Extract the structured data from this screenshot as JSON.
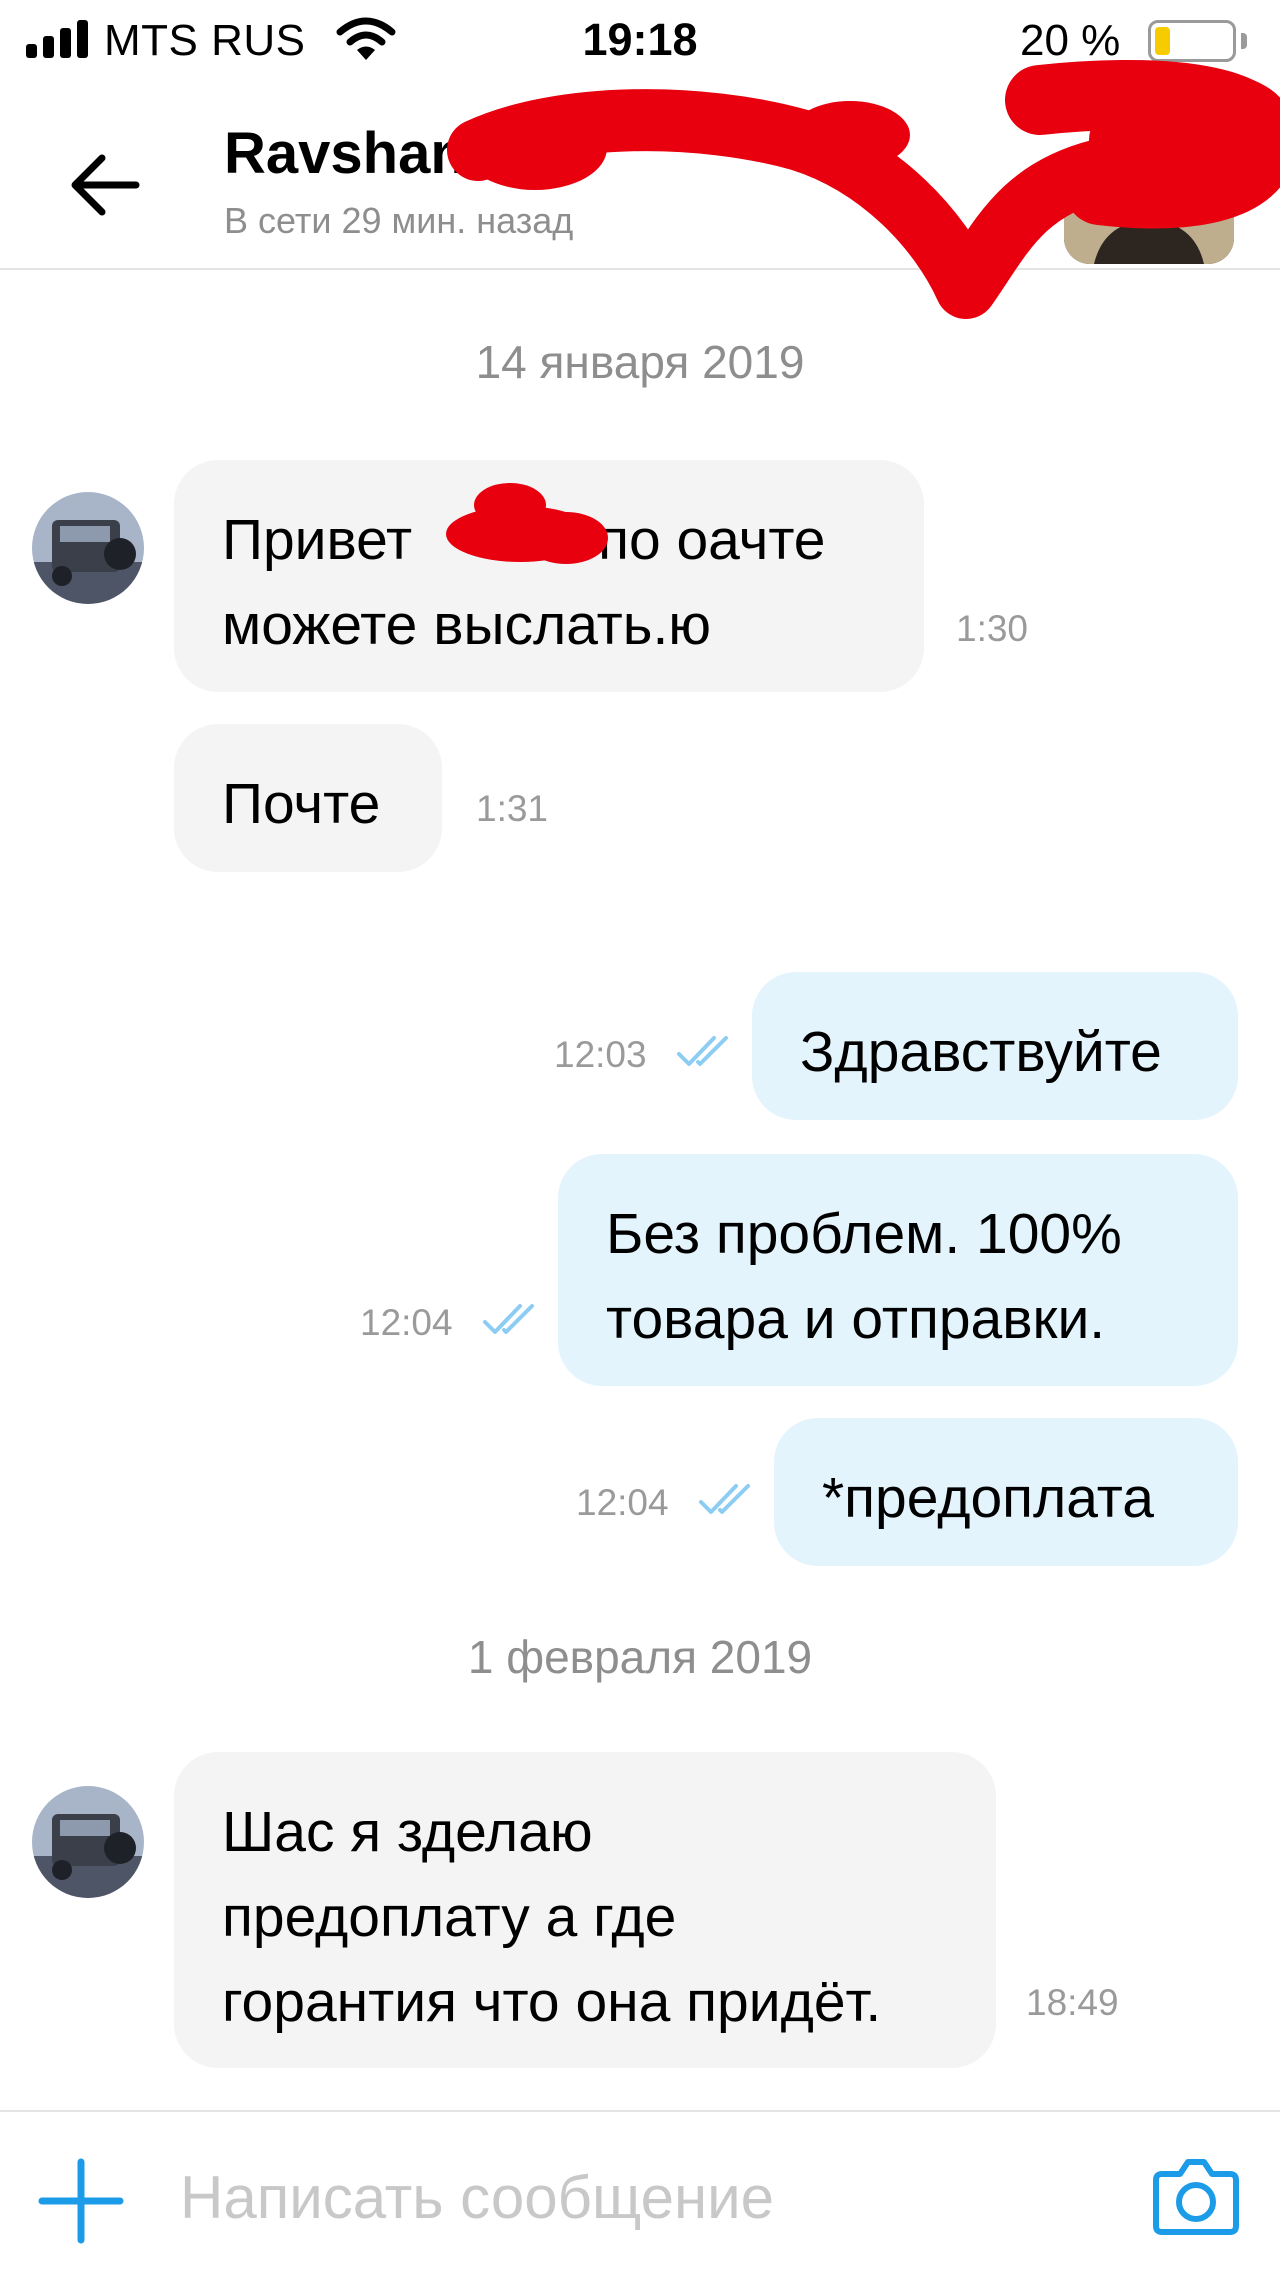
{
  "status_bar": {
    "carrier": "MTS RUS",
    "time": "19:18",
    "battery_text": "20 %",
    "battery_level": 0.2
  },
  "header": {
    "contact_name": "Ravshan",
    "contact_status": "В сети 29 мин. назад"
  },
  "chat": {
    "date_1": "14 января 2019",
    "date_2": "1 февраля 2019",
    "messages": [
      {
        "direction": "incoming",
        "text_before": "Привет",
        "text_after": "по оачте",
        "text_line2": "можете выслать.ю",
        "time": "1:30"
      },
      {
        "direction": "incoming",
        "text": "Почте",
        "time": "1:31"
      },
      {
        "direction": "outgoing",
        "text": "Здравствуйте",
        "time": "12:03",
        "read": true
      },
      {
        "direction": "outgoing",
        "text": "Без проблем. 100%\nтовара и отправки.",
        "time": "12:04",
        "read": true
      },
      {
        "direction": "outgoing",
        "text": "*предоплата",
        "time": "12:04",
        "read": true
      },
      {
        "direction": "incoming",
        "text": "Шас я зделаю\nпредоплату а где\nгорантия что она придёт.",
        "time": "18:49"
      }
    ]
  },
  "composer": {
    "placeholder": "Написать сообщение"
  },
  "colors": {
    "accent": "#1c9ce8",
    "incoming_bubble": "#f4f4f4",
    "outgoing_bubble": "#e3f4fd",
    "read_ticks": "#8dcdf3",
    "redaction": "#e8000f",
    "battery": "#f6cc00"
  },
  "icons": [
    "cellular-signal-icon",
    "wifi-icon",
    "battery-icon",
    "back-arrow-icon",
    "double-check-icon",
    "plus-icon",
    "camera-icon"
  ]
}
